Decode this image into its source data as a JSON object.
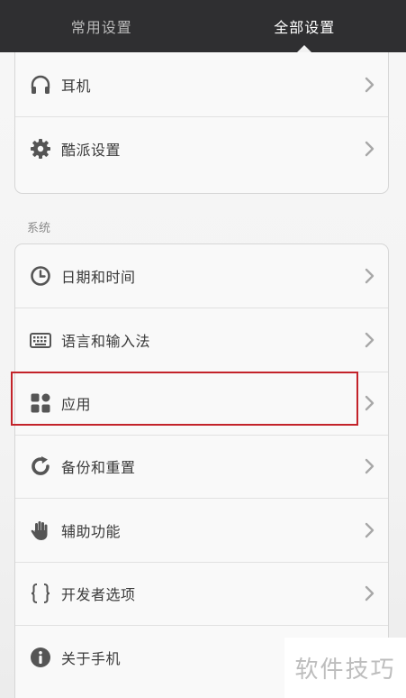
{
  "tabs": [
    {
      "label": "常用设置",
      "active": false
    },
    {
      "label": "全部设置",
      "active": true
    }
  ],
  "group1": {
    "items": [
      {
        "label": "耳机",
        "icon": "headphones-icon"
      },
      {
        "label": "酷派设置",
        "icon": "gear-icon"
      }
    ]
  },
  "system_section": {
    "title": "系统",
    "items": [
      {
        "label": "日期和时间",
        "icon": "clock-icon"
      },
      {
        "label": "语言和输入法",
        "icon": "keyboard-icon"
      },
      {
        "label": "应用",
        "icon": "apps-grid-icon"
      },
      {
        "label": "备份和重置",
        "icon": "backup-refresh-icon"
      },
      {
        "label": "辅助功能",
        "icon": "hand-icon"
      },
      {
        "label": "开发者选项",
        "icon": "braces-icon"
      },
      {
        "label": "关于手机",
        "icon": "info-icon"
      }
    ]
  },
  "highlighted_item": "应用",
  "highlight_color": "#c3232a",
  "watermark": "软件技巧"
}
